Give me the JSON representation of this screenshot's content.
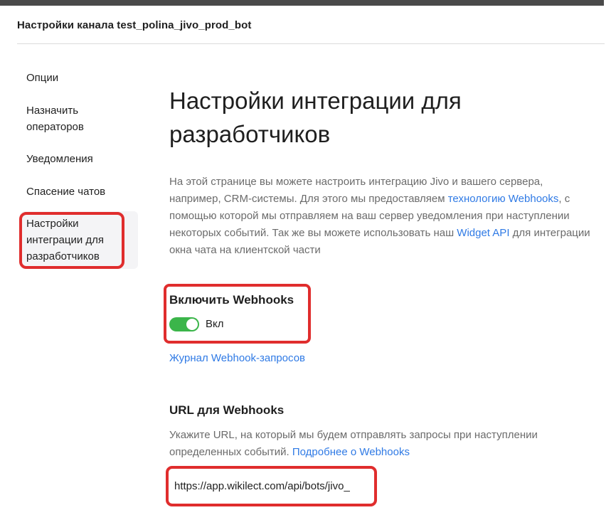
{
  "header": {
    "channel_title": "Настройки канала test_polina_jivo_prod_bot"
  },
  "sidebar": {
    "items": [
      {
        "label": "Опции"
      },
      {
        "label": "Назначить операторов"
      },
      {
        "label": "Уведомления"
      },
      {
        "label": "Спасение чатов"
      },
      {
        "label": "Настройки интеграции для разработчиков",
        "active": true
      }
    ]
  },
  "main": {
    "title": "Настройки интеграции для разработчиков",
    "intro": {
      "part1": "На этой странице вы можете настроить интеграцию Jivo и вашего сервера, например, CRM-системы. Для этого мы предоставляем ",
      "link1": "технологию Webhooks",
      "part2": ", с помощью которой мы отправляем на ваш сервер уведомления при наступлении некоторых событий. Так же вы можете использовать наш ",
      "link2": "Widget API",
      "part3": " для интеграции окна чата на клиентской части"
    },
    "webhooks": {
      "label": "Включить Webhooks",
      "toggle_state": "Вкл",
      "enabled": true
    },
    "journal_link": "Журнал Webhook-запросов",
    "url_section": {
      "label": "URL для Webhooks",
      "desc": "Укажите URL, на который мы будем отправлять запросы при наступлении определенных событий. ",
      "desc_link": "Подробнее о Webhooks",
      "input_value": "https://app.wikilect.com/api/bots/jivo_"
    }
  },
  "colors": {
    "accent_link": "#2f7ae5",
    "toggle_on": "#3bb54a",
    "highlight_red": "#e02d2d"
  }
}
